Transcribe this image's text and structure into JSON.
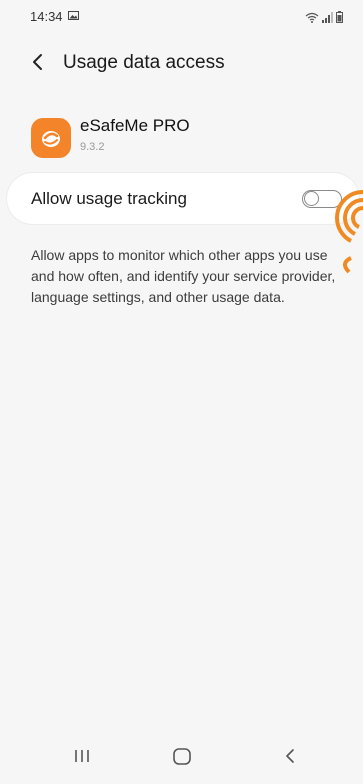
{
  "status_bar": {
    "time": "14:34",
    "icons": [
      "gallery-icon",
      "wifi-icon",
      "signal-icon",
      "battery-icon"
    ]
  },
  "header": {
    "title": "Usage data access",
    "back_icon": "chevron-left-icon"
  },
  "app": {
    "name": "eSafeMe PRO",
    "version": "9.3.2",
    "icon": "esafeme-app-icon",
    "icon_color": "#f4842a"
  },
  "setting": {
    "label": "Allow usage tracking",
    "enabled": false
  },
  "description": "Allow apps to monitor which other apps you use and how often, and identify your service provider, language settings, and other usage data.",
  "nav_bar": {
    "recents_icon": "recents-icon",
    "home_icon": "home-icon",
    "back_icon": "back-icon"
  },
  "colors": {
    "background": "#f6f6f6",
    "card": "#ffffff",
    "accent": "#f4842a"
  }
}
